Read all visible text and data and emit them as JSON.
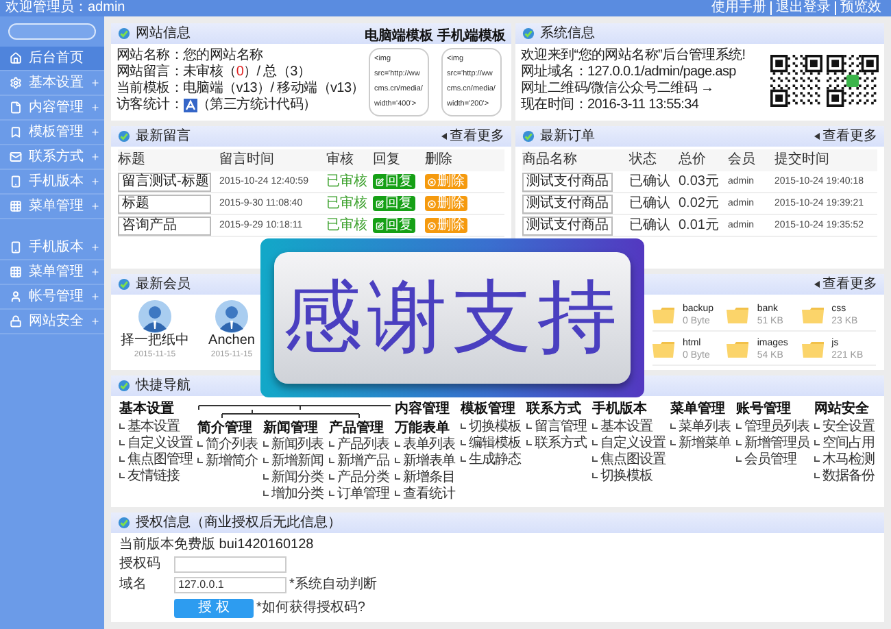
{
  "top_bar": {
    "welcome": "欢迎管理员：admin",
    "links": [
      "使用手册",
      "退出登录",
      "预览效"
    ]
  },
  "sidebar": {
    "groups": [
      {
        "items": [
          {
            "label": "后台首页",
            "selected": true,
            "expandable": false
          },
          {
            "label": "基本设置",
            "selected": false,
            "expandable": true
          },
          {
            "label": "内容管理",
            "selected": false,
            "expandable": true
          },
          {
            "label": "模板管理",
            "selected": false,
            "expandable": true
          },
          {
            "label": "联系方式",
            "selected": false,
            "expandable": true
          },
          {
            "label": "手机版本",
            "selected": false,
            "expandable": true
          },
          {
            "label": "菜单管理",
            "selected": false,
            "expandable": true
          }
        ]
      },
      {
        "items": [
          {
            "label": "手机版本",
            "selected": false,
            "expandable": true
          },
          {
            "label": "菜单管理",
            "selected": false,
            "expandable": true
          },
          {
            "label": "帐号管理",
            "selected": false,
            "expandable": true
          },
          {
            "label": "网站安全",
            "selected": false,
            "expandable": true
          }
        ]
      }
    ]
  },
  "site_info": {
    "title": "网站信息",
    "lines": [
      {
        "kind": "text",
        "text": "网站名称：您的网站名称"
      },
      {
        "kind": "messages",
        "prefix": "网站留言：未审核（",
        "unreviewed": "0",
        "suffix": "）/ 总（3）"
      },
      {
        "kind": "text",
        "text": "当前模板：电脑端（v13）/ 移动端（v13）"
      },
      {
        "kind": "stats",
        "label": "访客统计：",
        "note": "（第三方统计代码）"
      }
    ],
    "templates": [
      {
        "title": "电脑端模板",
        "alt_lines": [
          "<img",
          "src='http://ww",
          "cms.cn/media/",
          "width='400'>"
        ]
      },
      {
        "title": "手机端模板",
        "alt_lines": [
          "<img",
          "src='http://ww",
          "cms.cn/media/",
          "width='200'>"
        ]
      }
    ]
  },
  "system_info": {
    "title": "系统信息",
    "lines": [
      "欢迎来到“您的网站名称”后台管理系统!",
      "网址域名：127.0.0.1/admin/page.asp",
      "网址二维码/微信公众号二维码 →",
      "现在时间：2016-3-11 13:55:34"
    ]
  },
  "messages": {
    "title": "最新留言",
    "more": "查看更多",
    "columns": [
      "标题",
      "留言时间",
      "审核",
      "回复",
      "删除"
    ],
    "rows": [
      {
        "title": "留言测试-标题",
        "time": "2015-10-24 12:40:59",
        "status": "已审核",
        "reply": "回复",
        "delete": "删除"
      },
      {
        "title": "标题",
        "time": "2015-9-30 11:08:40",
        "status": "已审核",
        "reply": "回复",
        "delete": "删除"
      },
      {
        "title": "咨询产品",
        "time": "2015-9-29 10:18:11",
        "status": "已审核",
        "reply": "回复",
        "delete": "删除"
      }
    ]
  },
  "orders": {
    "title": "最新订单",
    "more": "查看更多",
    "columns": [
      "商品名称",
      "状态",
      "总价",
      "会员",
      "提交时间"
    ],
    "rows": [
      {
        "product": "测试支付商品",
        "status": "已确认",
        "total": "0.03元",
        "member": "admin",
        "time": "2015-10-24 19:40:18"
      },
      {
        "product": "测试支付商品",
        "status": "已确认",
        "total": "0.02元",
        "member": "admin",
        "time": "2015-10-24 19:39:21"
      },
      {
        "product": "测试支付商品",
        "status": "已确认",
        "total": "0.01元",
        "member": "admin",
        "time": "2015-10-24 19:35:52"
      }
    ]
  },
  "members": {
    "title": "最新会员",
    "items": [
      {
        "name": "择一把纸中",
        "date": "2015-11-15"
      },
      {
        "name": "Anchen",
        "date": "2015-11-15"
      }
    ]
  },
  "files": {
    "more": "查看更多",
    "items": [
      {
        "name": "backup",
        "size": "0 Byte"
      },
      {
        "name": "bank",
        "size": "51 KB"
      },
      {
        "name": "css",
        "size": "23 KB"
      },
      {
        "name": "html",
        "size": "0 Byte"
      },
      {
        "name": "images",
        "size": "54 KB"
      },
      {
        "name": "js",
        "size": "221 KB"
      }
    ]
  },
  "quick_nav": {
    "title": "快捷导航",
    "group_label": "内容管理",
    "columns": [
      {
        "heading": "基本设置",
        "grouped": false,
        "items": [
          "基本设置",
          "自定义设置",
          "焦点图管理",
          "友情链接"
        ]
      },
      {
        "heading": "简介管理",
        "grouped": true,
        "items": [
          "简介列表",
          "新增简介"
        ]
      },
      {
        "heading": "新闻管理",
        "grouped": true,
        "items": [
          "新闻列表",
          "新增新闻",
          "新闻分类",
          "增加分类"
        ]
      },
      {
        "heading": "产品管理",
        "grouped": true,
        "items": [
          "产品列表",
          "新增产品",
          "产品分类",
          "订单管理"
        ]
      },
      {
        "heading": "万能表单",
        "grouped": true,
        "items": [
          "表单列表",
          "新增表单",
          "新增条目",
          "查看统计"
        ]
      },
      {
        "heading": "模板管理",
        "grouped": false,
        "items": [
          "切换模板",
          "编辑模板",
          "生成静态"
        ]
      },
      {
        "heading": "联系方式",
        "grouped": false,
        "items": [
          "留言管理",
          "联系方式"
        ]
      },
      {
        "heading": "手机版本",
        "grouped": false,
        "items": [
          "基本设置",
          "自定义设置",
          "焦点图设置",
          "切换模板"
        ]
      },
      {
        "heading": "菜单管理",
        "grouped": false,
        "items": [
          "菜单列表",
          "新增菜单"
        ]
      },
      {
        "heading": "账号管理",
        "grouped": false,
        "items": [
          "管理员列表",
          "新增管理员",
          "会员管理"
        ]
      },
      {
        "heading": "网站安全",
        "grouped": false,
        "items": [
          "安全设置",
          "空间占用",
          "木马检测",
          "数据备份"
        ]
      }
    ]
  },
  "license": {
    "title": "授权信息（商业授权后无此信息）",
    "rows": [
      {
        "kind": "text",
        "label": "当前版本",
        "value": "免费版 bui1420160128"
      },
      {
        "kind": "field",
        "label": "授权码"
      },
      {
        "kind": "field",
        "label": "域名",
        "value": "127.0.0.1",
        "note": "*系统自动判断"
      },
      {
        "kind": "button",
        "button": "授 权",
        "link": "*如何获得授权码?"
      }
    ]
  },
  "banner": {
    "text": "感谢支持"
  }
}
